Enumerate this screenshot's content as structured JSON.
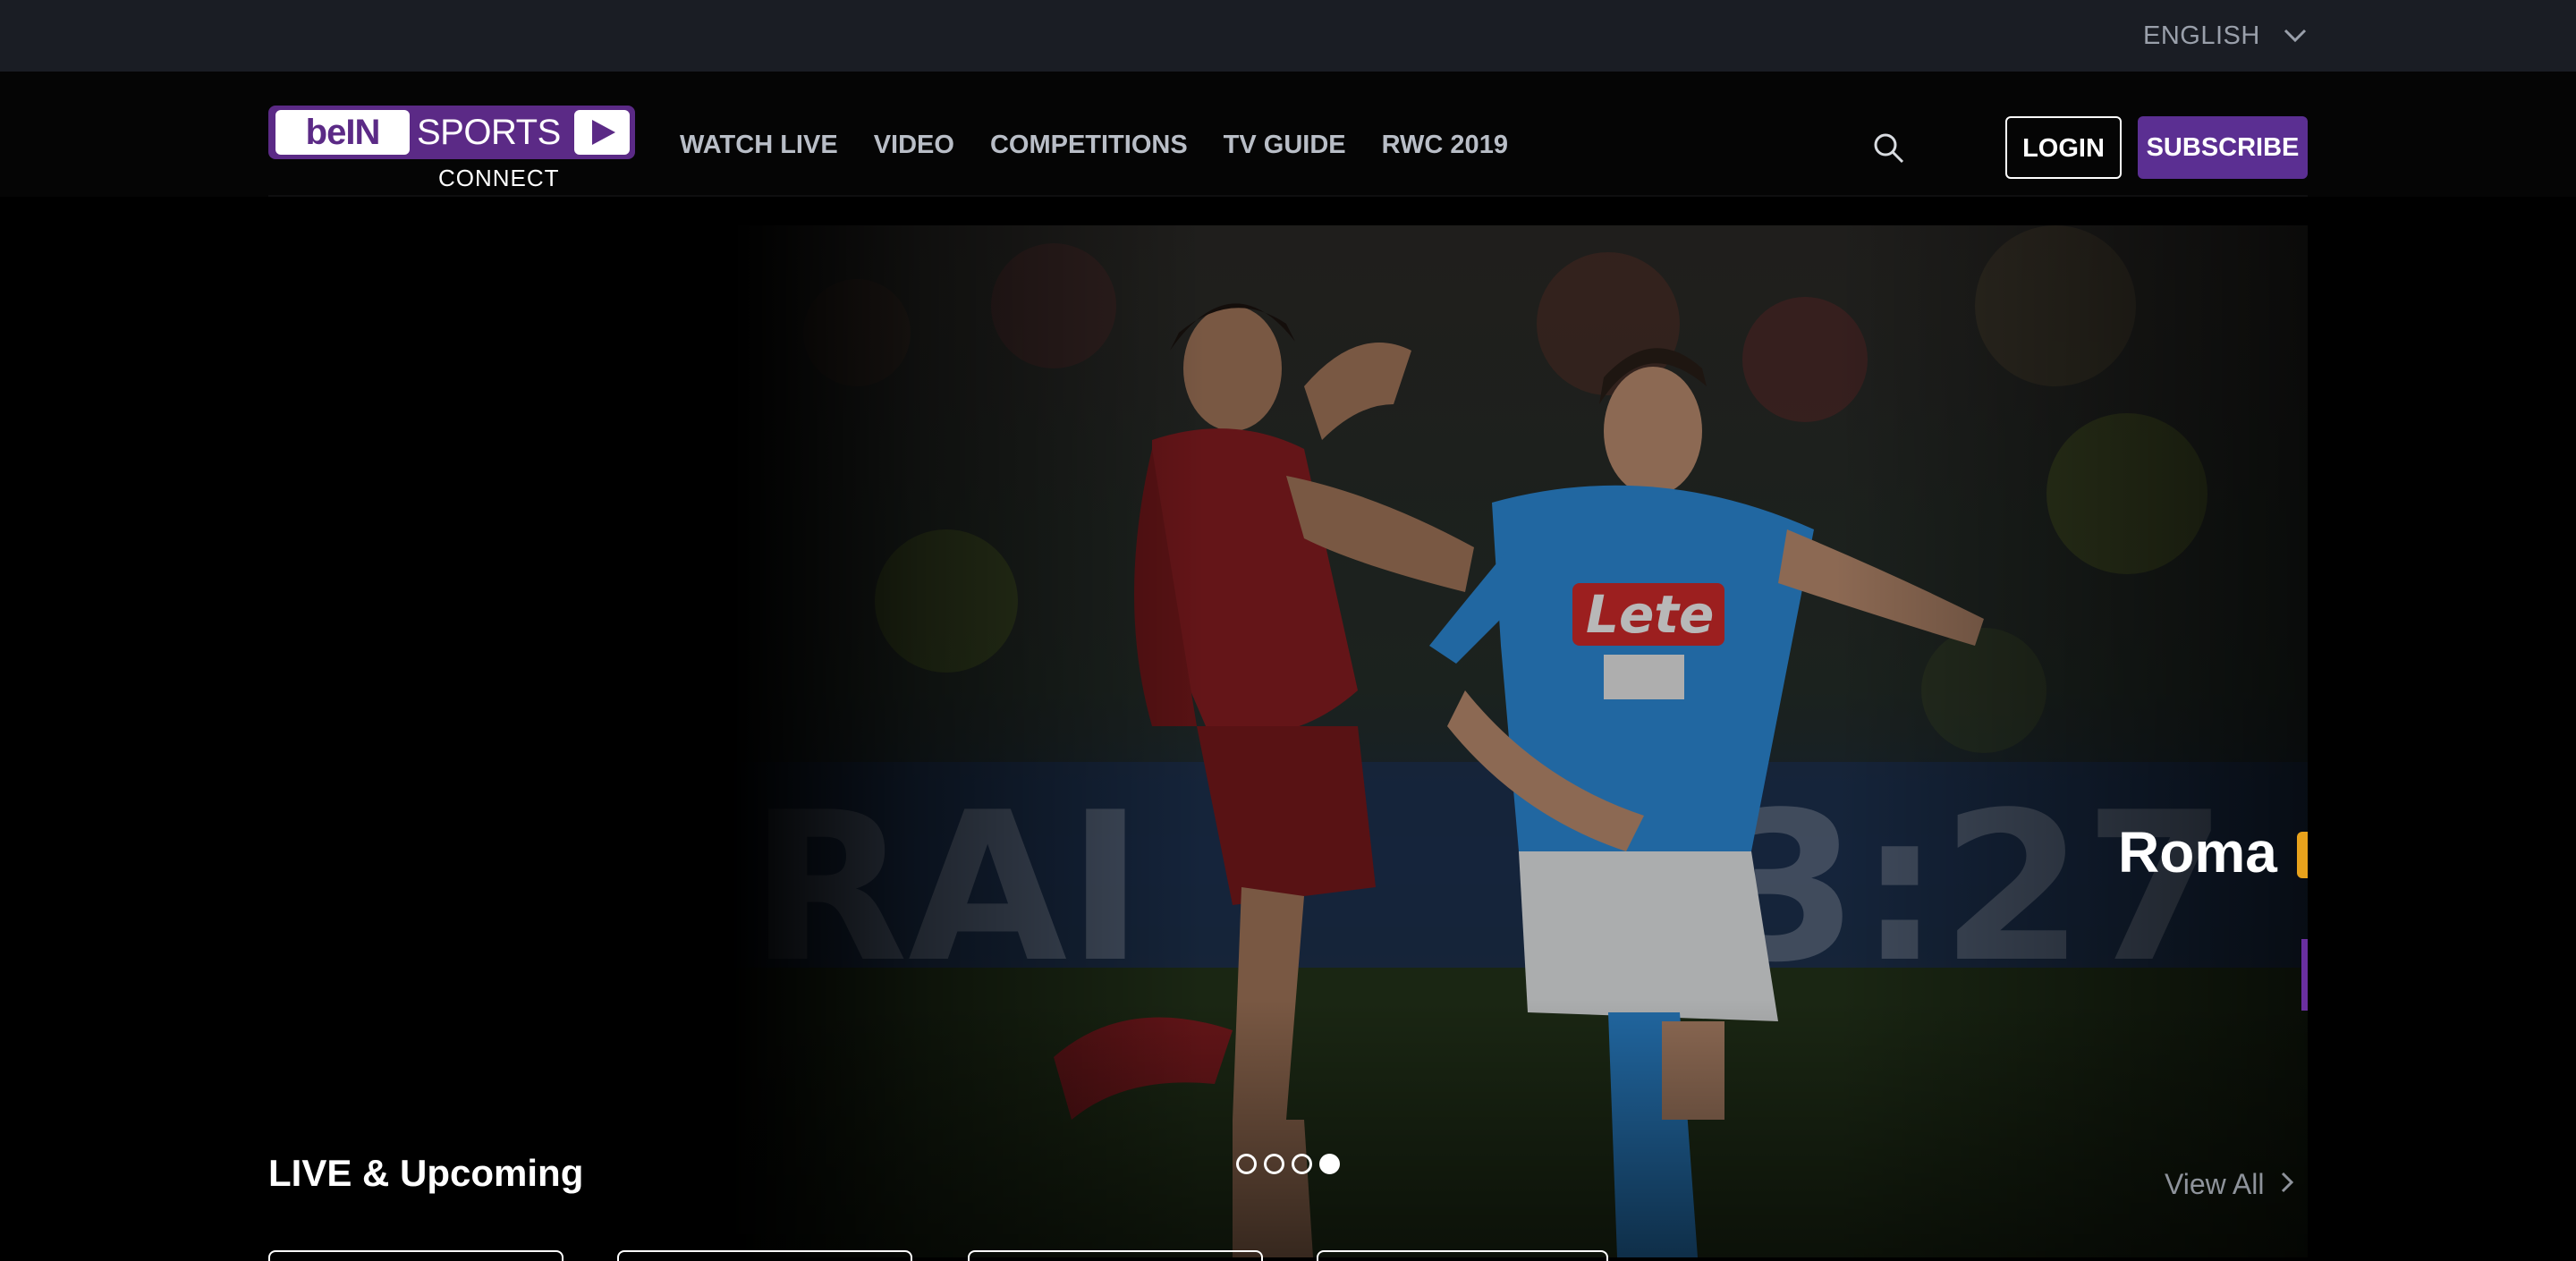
{
  "language": {
    "label": "ENGLISH",
    "icon": "chevron-down-icon"
  },
  "logo": {
    "primary": "beIN",
    "secondary": "SPORTS",
    "sub": "CONNECT"
  },
  "nav": [
    {
      "label": "WATCH LIVE"
    },
    {
      "label": "VIDEO"
    },
    {
      "label": "COMPETITIONS"
    },
    {
      "label": "TV GUIDE"
    },
    {
      "label": "RWC 2019"
    }
  ],
  "header": {
    "search_icon": "search-icon",
    "login_label": "LOGIN",
    "subscribe_label": "SUBSCRIBE"
  },
  "hero": {
    "team_label": "Roma",
    "slides": {
      "count": 4,
      "active_index": 3
    }
  },
  "section": {
    "title": "LIVE & Upcoming",
    "view_all": "View All"
  },
  "colors": {
    "brand_purple": "#5b2f92",
    "top_bar": "#1a1d24",
    "nav_text": "#b9bec7",
    "napoli_blue": "#2f8fe0",
    "roma_red": "#8b1e22"
  }
}
